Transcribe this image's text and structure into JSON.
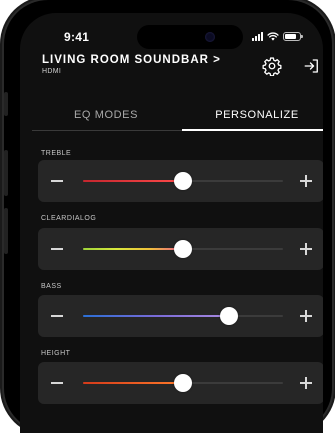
{
  "status_bar": {
    "time": "9:41",
    "icons": [
      "cellular-signal-icon",
      "wifi-icon",
      "battery-icon"
    ],
    "battery_level": 0.8
  },
  "header": {
    "device_title": "LIVING ROOM SOUNDBAR >",
    "device_input": "HDMI",
    "icons": [
      "gear-icon",
      "exit-icon"
    ]
  },
  "tabs": [
    {
      "label": "EQ MODES",
      "active": false
    },
    {
      "label": "PERSONALIZE",
      "active": true
    }
  ],
  "sliders": [
    {
      "label": "TREBLE",
      "value": 0.5,
      "gradient": [
        "#c4262e",
        "#ff4a4a"
      ]
    },
    {
      "label": "CLEARDIALOG",
      "value": 0.5,
      "gradient": [
        "#9fd43a",
        "#d8e83c",
        "#f0c03a",
        "#e85a8c"
      ]
    },
    {
      "label": "BASS",
      "value": 0.73,
      "gradient": [
        "#2a6fd6",
        "#7a6bd8",
        "#a98ae0"
      ]
    },
    {
      "label": "HEIGHT",
      "value": 0.5,
      "gradient": [
        "#d43a1a",
        "#ff7a2a"
      ]
    }
  ],
  "colors": {
    "background": "#101010",
    "card": "#262626",
    "active_text": "#ffffff",
    "inactive_text": "#a9a9a9"
  }
}
